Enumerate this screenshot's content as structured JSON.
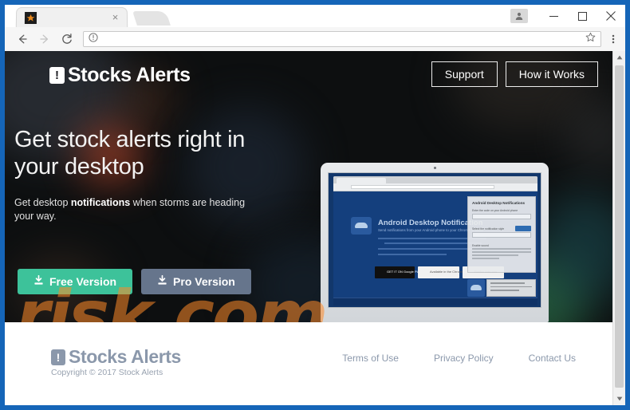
{
  "browser": {
    "tab": {
      "title": "",
      "favicon": "star-favicon",
      "close_label": "×"
    },
    "new_tab_label": "+",
    "window_controls": {
      "profile": "profile-icon",
      "minimize": "–",
      "maximize": "□",
      "close": "✕"
    },
    "toolbar": {
      "back": "back-arrow-icon",
      "forward": "forward-arrow-icon",
      "reload": "reload-icon",
      "site_info": "info-icon",
      "url": "",
      "url_placeholder": "",
      "bookmark": "star-icon",
      "menu": "three-dot-menu-icon"
    },
    "scrollbar": {
      "up": "▲",
      "down": "▼"
    }
  },
  "site": {
    "header": {
      "brand": "Stocks Alerts",
      "logo_glyph": "!",
      "nav": [
        {
          "label": "Support"
        },
        {
          "label": "How it Works"
        }
      ]
    },
    "hero": {
      "headline": "Get stock alerts right in your desktop",
      "subhead_before": "Get desktop ",
      "subhead_bold": "notifications",
      "subhead_after": " when storms are heading your way.",
      "buttons": [
        {
          "label": "Free Version",
          "icon": "download-icon",
          "color": "#3dc29a"
        },
        {
          "label": "Pro Version",
          "icon": "download-icon",
          "color": "#66758c"
        }
      ]
    },
    "mockup": {
      "page_title": "Android Desktop Notification",
      "page_subtitle": "Send notifications from your Android phone to your Chrome browser",
      "panel_title": "Android Desktop Notifications",
      "panel_label_1": "Enter the code on your Android phone",
      "panel_button": "Send",
      "panel_label_2": "Select the notification style",
      "panel_select": "1 line text, expands",
      "panel_checkbox": "Enable sound",
      "badges": [
        {
          "label": "GET IT ON Google Play"
        },
        {
          "label": "Available in the Chrome Web Store"
        },
        {
          "label": "Firefox Add-ons"
        }
      ],
      "toast_title": "Stocks Alerts Notification"
    },
    "footer": {
      "brand": "Stocks Alerts",
      "logo_glyph": "!",
      "copyright": "Copyright © 2017 Stock Alerts",
      "links": [
        {
          "label": "Terms of Use"
        },
        {
          "label": "Privacy Policy"
        },
        {
          "label": "Contact Us"
        }
      ]
    },
    "watermark": "risk.com"
  },
  "theme": {
    "window_border": "#1565b8",
    "hero_bg": "#0d0f10",
    "accent_green": "#3dc29a",
    "accent_slate": "#66758c",
    "footer_text": "#8b98ab",
    "watermark_color": "#ff8a28"
  }
}
